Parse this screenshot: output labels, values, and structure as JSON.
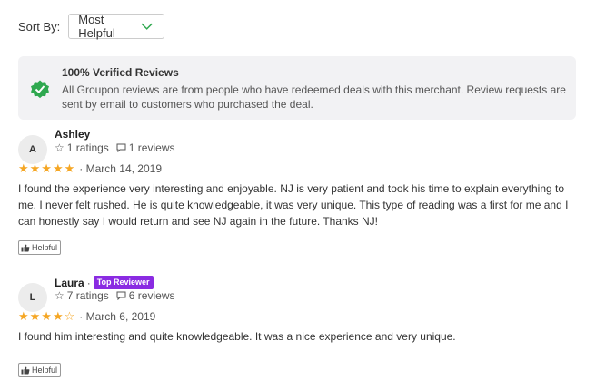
{
  "sort": {
    "label": "Sort By:",
    "selected": "Most Helpful"
  },
  "verified": {
    "title": "100% Verified Reviews",
    "text": "All Groupon reviews are from people who have redeemed deals with this merchant. Review requests are sent by email to customers who purchased the deal."
  },
  "colors": {
    "star": "#f5a623",
    "verified_badge": "#2fa84f",
    "top_reviewer_badge": "#8a2be2",
    "panel_bg": "#f2f2f4"
  },
  "reviews": [
    {
      "initial": "A",
      "name": "Ashley",
      "ratings": "1 ratings",
      "reviews_count": "1 reviews",
      "stars": 5,
      "stars_display": "★★★★★",
      "date": "· March 14, 2019",
      "text": "I found the experience very interesting and enjoyable. NJ is very patient and took his time to explain everything to me. I never felt rushed. He is quite knowledgeable, it was very unique. This type of reading was a first for me and I can honestly say I would return and see NJ again in the future. Thanks NJ!",
      "helpful": "Helpful"
    },
    {
      "initial": "L",
      "name": "Laura",
      "separator": "·",
      "badge": "Top Reviewer",
      "ratings": "7 ratings",
      "reviews_count": "6 reviews",
      "stars": 4,
      "stars_display": "★★★★☆",
      "date": "· March 6, 2019",
      "text": "I found him interesting and quite knowledgeable. It was a nice experience and very unique.",
      "helpful": "Helpful"
    }
  ]
}
